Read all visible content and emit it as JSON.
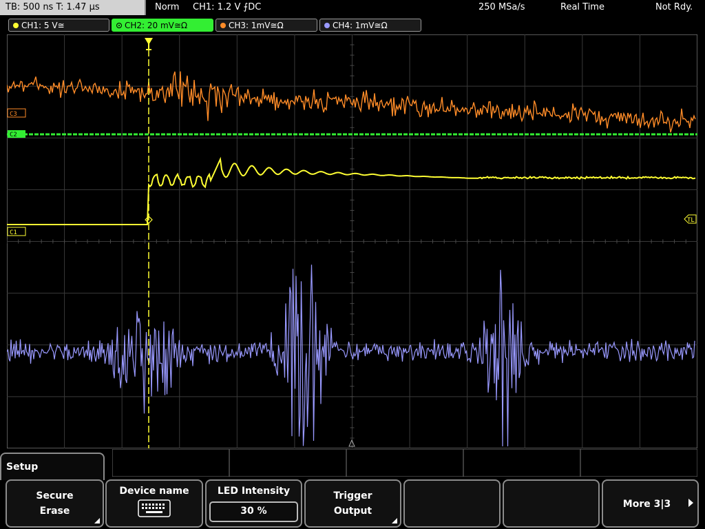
{
  "status": {
    "timebase": "TB: 500 ns  T: 1.47 µs",
    "mode": "Norm",
    "trigger": "CH1: 1.2 V ⨍DC",
    "sample_rate": "250 MSa/s",
    "acq_mode": "Real Time",
    "state": "Not Rdy."
  },
  "channels": [
    {
      "label": "CH1: 5 V≅",
      "color": "#ffff33"
    },
    {
      "label": "CH2: 20 mV≅Ω",
      "color": "#33ee33"
    },
    {
      "label": "CH3: 1mV≅Ω",
      "color": "#ff8c28"
    },
    {
      "label": "CH4: 1mV≅Ω",
      "color": "#9999ff"
    }
  ],
  "markers": {
    "c3": "C3",
    "c1": "C1",
    "c2": "C2",
    "tl": "TL",
    "trigger": "T"
  },
  "menu": {
    "title": "Setup",
    "secure_erase_l1": "Secure",
    "secure_erase_l2": "Erase",
    "device_name": "Device name",
    "keyboard_icon": "keyboard-icon",
    "led_label": "LED Intensity",
    "led_value": "30 %",
    "trigger_output_l1": "Trigger",
    "trigger_output_l2": "Output",
    "more": "More 3|3"
  }
}
